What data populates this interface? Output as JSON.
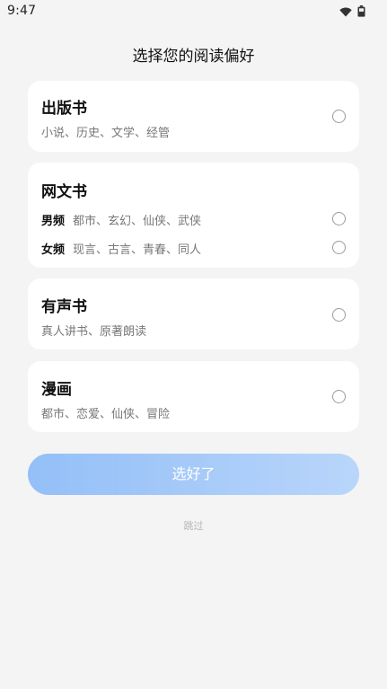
{
  "status_bar": {
    "time": "9:47",
    "icons": [
      "wifi-icon",
      "battery-icon"
    ]
  },
  "page": {
    "title": "选择您的阅读偏好"
  },
  "cards": [
    {
      "title": "出版书",
      "subtitle": "小说、历史、文学、经管"
    },
    {
      "title": "网文书",
      "rows": [
        {
          "label": "男频",
          "tags": "都市、玄幻、仙侠、武侠"
        },
        {
          "label": "女频",
          "tags": "现言、古言、青春、同人"
        }
      ]
    },
    {
      "title": "有声书",
      "subtitle": "真人讲书、原著朗读"
    },
    {
      "title": "漫画",
      "subtitle": "都市、恋爱、仙侠、冒险"
    }
  ],
  "actions": {
    "submit_label": "选好了",
    "skip_label": "跳过"
  },
  "colors": {
    "background": "#f4f4f4",
    "card": "#ffffff",
    "button_gradient_start": "#8ebcf8",
    "button_gradient_end": "#b6d4fb"
  }
}
